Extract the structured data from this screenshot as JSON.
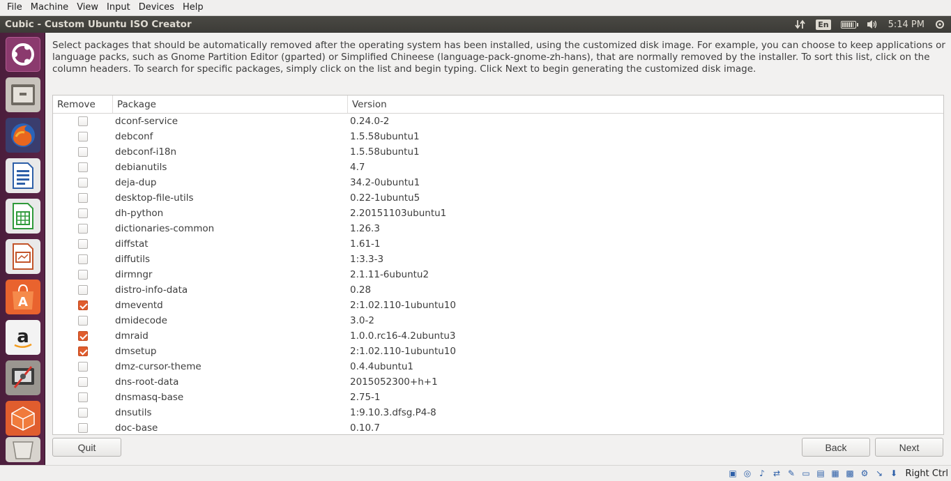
{
  "host_menu": {
    "items": [
      "File",
      "Machine",
      "View",
      "Input",
      "Devices",
      "Help"
    ]
  },
  "top_panel": {
    "window_title": "Cubic - Custom Ubuntu ISO Creator",
    "keyboard_layout": "En",
    "time": "5:14 PM"
  },
  "launcher": {
    "icons": [
      "ubuntu-dash-icon",
      "files-icon",
      "firefox-icon",
      "libreoffice-writer-icon",
      "libreoffice-calc-icon",
      "libreoffice-impress-icon",
      "software-center-icon",
      "amazon-icon",
      "system-settings-icon",
      "cubic-icon",
      "trash-icon"
    ]
  },
  "main": {
    "description": "Select packages that should be automatically removed after the operating system has been installed, using the customized disk image. For example, you can choose to keep applications or language packs, such as Gnome Partition Editor (gparted) or Simplified Chineese (language-pack-gnome-zh-hans), that are normally removed by the installer. To sort this list, click on the column headers. To search for specific packages, simply click on the list and begin typing. Click Next to begin generating the customized disk image.",
    "columns": {
      "remove": "Remove",
      "package": "Package",
      "version": "Version"
    },
    "rows": [
      {
        "checked": false,
        "package": "dconf-service",
        "version": "0.24.0-2"
      },
      {
        "checked": false,
        "package": "debconf",
        "version": "1.5.58ubuntu1"
      },
      {
        "checked": false,
        "package": "debconf-i18n",
        "version": "1.5.58ubuntu1"
      },
      {
        "checked": false,
        "package": "debianutils",
        "version": "4.7"
      },
      {
        "checked": false,
        "package": "deja-dup",
        "version": "34.2-0ubuntu1"
      },
      {
        "checked": false,
        "package": "desktop-file-utils",
        "version": "0.22-1ubuntu5"
      },
      {
        "checked": false,
        "package": "dh-python",
        "version": "2.20151103ubuntu1"
      },
      {
        "checked": false,
        "package": "dictionaries-common",
        "version": "1.26.3"
      },
      {
        "checked": false,
        "package": "diffstat",
        "version": "1.61-1"
      },
      {
        "checked": false,
        "package": "diffutils",
        "version": "1:3.3-3"
      },
      {
        "checked": false,
        "package": "dirmngr",
        "version": "2.1.11-6ubuntu2"
      },
      {
        "checked": false,
        "package": "distro-info-data",
        "version": "0.28"
      },
      {
        "checked": true,
        "package": "dmeventd",
        "version": "2:1.02.110-1ubuntu10"
      },
      {
        "checked": false,
        "package": "dmidecode",
        "version": "3.0-2"
      },
      {
        "checked": true,
        "package": "dmraid",
        "version": "1.0.0.rc16-4.2ubuntu3"
      },
      {
        "checked": true,
        "package": "dmsetup",
        "version": "2:1.02.110-1ubuntu10"
      },
      {
        "checked": false,
        "package": "dmz-cursor-theme",
        "version": "0.4.4ubuntu1"
      },
      {
        "checked": false,
        "package": "dns-root-data",
        "version": "2015052300+h+1"
      },
      {
        "checked": false,
        "package": "dnsmasq-base",
        "version": "2.75-1"
      },
      {
        "checked": false,
        "package": "dnsutils",
        "version": "1:9.10.3.dfsg.P4-8"
      },
      {
        "checked": false,
        "package": "doc-base",
        "version": "0.10.7"
      }
    ],
    "buttons": {
      "quit": "Quit",
      "back": "Back",
      "next": "Next"
    }
  },
  "status_bar": {
    "host_key": "Right Ctrl"
  },
  "colors": {
    "accent": "#e05d2e",
    "launcher": "#5a2447",
    "panel": "#3c3b37"
  }
}
